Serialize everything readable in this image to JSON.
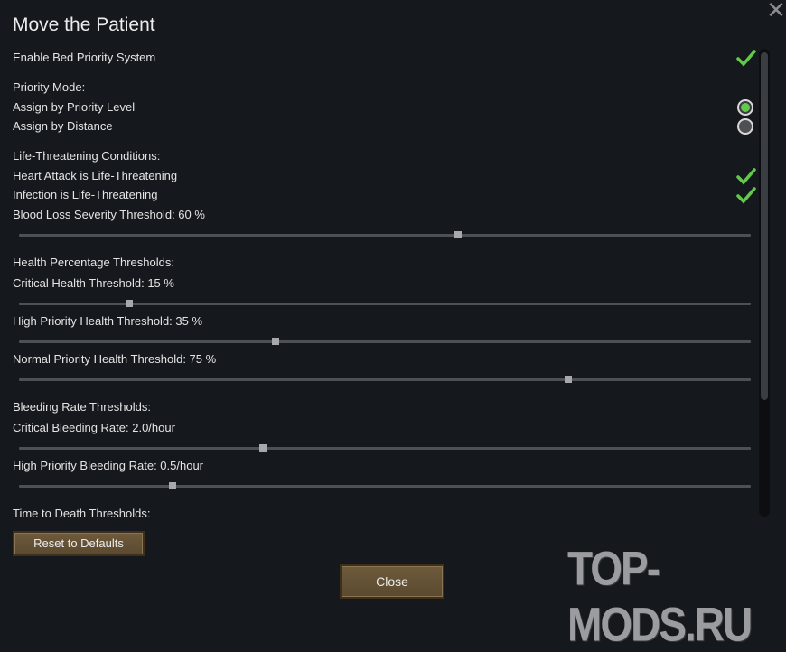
{
  "window": {
    "title": "Move the Patient"
  },
  "settings": {
    "enable_bed_priority": {
      "label": "Enable Bed Priority System",
      "checked": true
    },
    "priority_mode": {
      "heading": "Priority Mode:",
      "options": [
        {
          "label": "Assign by Priority Level",
          "selected": true
        },
        {
          "label": "Assign by Distance",
          "selected": false
        }
      ]
    },
    "life_threatening": {
      "heading": "Life-Threatening Conditions:",
      "heart_attack": {
        "label": "Heart Attack is Life-Threatening",
        "checked": true
      },
      "infection": {
        "label": "Infection is Life-Threatening",
        "checked": true
      },
      "blood_loss": {
        "label": "Blood Loss Severity Threshold: 60 %",
        "value": 0.6
      }
    },
    "health_thresholds": {
      "heading": "Health Percentage Thresholds:",
      "critical": {
        "label": "Critical Health Threshold: 15 %",
        "value": 0.15
      },
      "high": {
        "label": "High Priority Health Threshold: 35 %",
        "value": 0.35
      },
      "normal": {
        "label": "Normal Priority Health Threshold: 75 %",
        "value": 0.75
      }
    },
    "bleeding_thresholds": {
      "heading": "Bleeding Rate Thresholds:",
      "critical": {
        "label": "Critical Bleeding Rate: 2.0/hour",
        "value": 0.333
      },
      "high": {
        "label": "High Priority Bleeding Rate: 0.5/hour",
        "value": 0.21
      }
    },
    "time_to_death": {
      "heading": "Time to Death Thresholds:"
    }
  },
  "buttons": {
    "reset_label": "Reset to Defaults",
    "close_label": "Close"
  },
  "icons": {
    "close": "close-icon",
    "check": "checkmark-icon"
  },
  "colors": {
    "check_green": "#63c94a",
    "button_brown": "#6e5a3c"
  },
  "watermark": "TOP-MODS.RU"
}
